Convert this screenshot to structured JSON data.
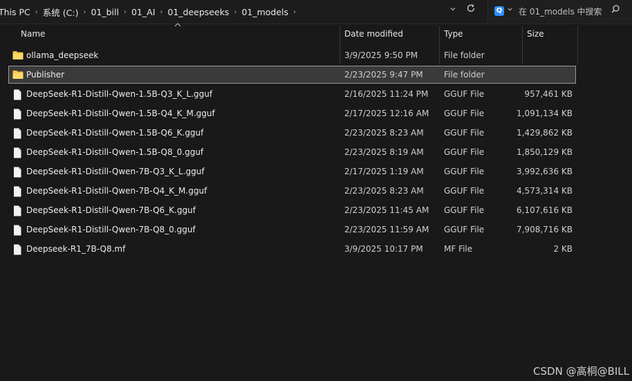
{
  "address_bar": {
    "crumbs": [
      "This PC",
      "系统 (C:)",
      "01_bill",
      "01_AI",
      "01_deepseeks",
      "01_models"
    ],
    "separator": "›",
    "dropdown_icon": "chevron-down-icon",
    "refresh_icon": "refresh-icon"
  },
  "search": {
    "placeholder": "在 01_models 中搜索",
    "badge": "Q"
  },
  "columns": {
    "name": "Name",
    "date": "Date modified",
    "type": "Type",
    "size": "Size"
  },
  "files": [
    {
      "name": "ollama_deepseek",
      "date": "3/9/2025 9:50 PM",
      "type": "File folder",
      "size": "",
      "icon": "folder-icon",
      "selected": false
    },
    {
      "name": "Publisher",
      "date": "2/23/2025 9:47 PM",
      "type": "File folder",
      "size": "",
      "icon": "folder-icon",
      "selected": true
    },
    {
      "name": "DeepSeek-R1-Distill-Qwen-1.5B-Q3_K_L.gguf",
      "date": "2/16/2025 11:24 PM",
      "type": "GGUF File",
      "size": "957,461 KB",
      "icon": "file-icon",
      "selected": false
    },
    {
      "name": "DeepSeek-R1-Distill-Qwen-1.5B-Q4_K_M.gguf",
      "date": "2/17/2025 12:16 AM",
      "type": "GGUF File",
      "size": "1,091,134 KB",
      "icon": "file-icon",
      "selected": false
    },
    {
      "name": "DeepSeek-R1-Distill-Qwen-1.5B-Q6_K.gguf",
      "date": "2/23/2025 8:23 AM",
      "type": "GGUF File",
      "size": "1,429,862 KB",
      "icon": "file-icon",
      "selected": false
    },
    {
      "name": "DeepSeek-R1-Distill-Qwen-1.5B-Q8_0.gguf",
      "date": "2/23/2025 8:19 AM",
      "type": "GGUF File",
      "size": "1,850,129 KB",
      "icon": "file-icon",
      "selected": false
    },
    {
      "name": "DeepSeek-R1-Distill-Qwen-7B-Q3_K_L.gguf",
      "date": "2/17/2025 1:19 AM",
      "type": "GGUF File",
      "size": "3,992,636 KB",
      "icon": "file-icon",
      "selected": false
    },
    {
      "name": "DeepSeek-R1-Distill-Qwen-7B-Q4_K_M.gguf",
      "date": "2/23/2025 8:23 AM",
      "type": "GGUF File",
      "size": "4,573,314 KB",
      "icon": "file-icon",
      "selected": false
    },
    {
      "name": "DeepSeek-R1-Distill-Qwen-7B-Q6_K.gguf",
      "date": "2/23/2025 11:45 AM",
      "type": "GGUF File",
      "size": "6,107,616 KB",
      "icon": "file-icon",
      "selected": false
    },
    {
      "name": "DeepSeek-R1-Distill-Qwen-7B-Q8_0.gguf",
      "date": "2/23/2025 11:59 AM",
      "type": "GGUF File",
      "size": "7,908,716 KB",
      "icon": "file-icon",
      "selected": false
    },
    {
      "name": "Deepseek-R1_7B-Q8.mf",
      "date": "3/9/2025 10:17 PM",
      "type": "MF File",
      "size": "2 KB",
      "icon": "file-icon",
      "selected": false
    }
  ],
  "watermark": "CSDN @高桐@BILL",
  "colors": {
    "background": "#191919",
    "selected_row": "#3a3a3a",
    "folder": "#f5c542",
    "search_badge": "#2f8dff"
  }
}
